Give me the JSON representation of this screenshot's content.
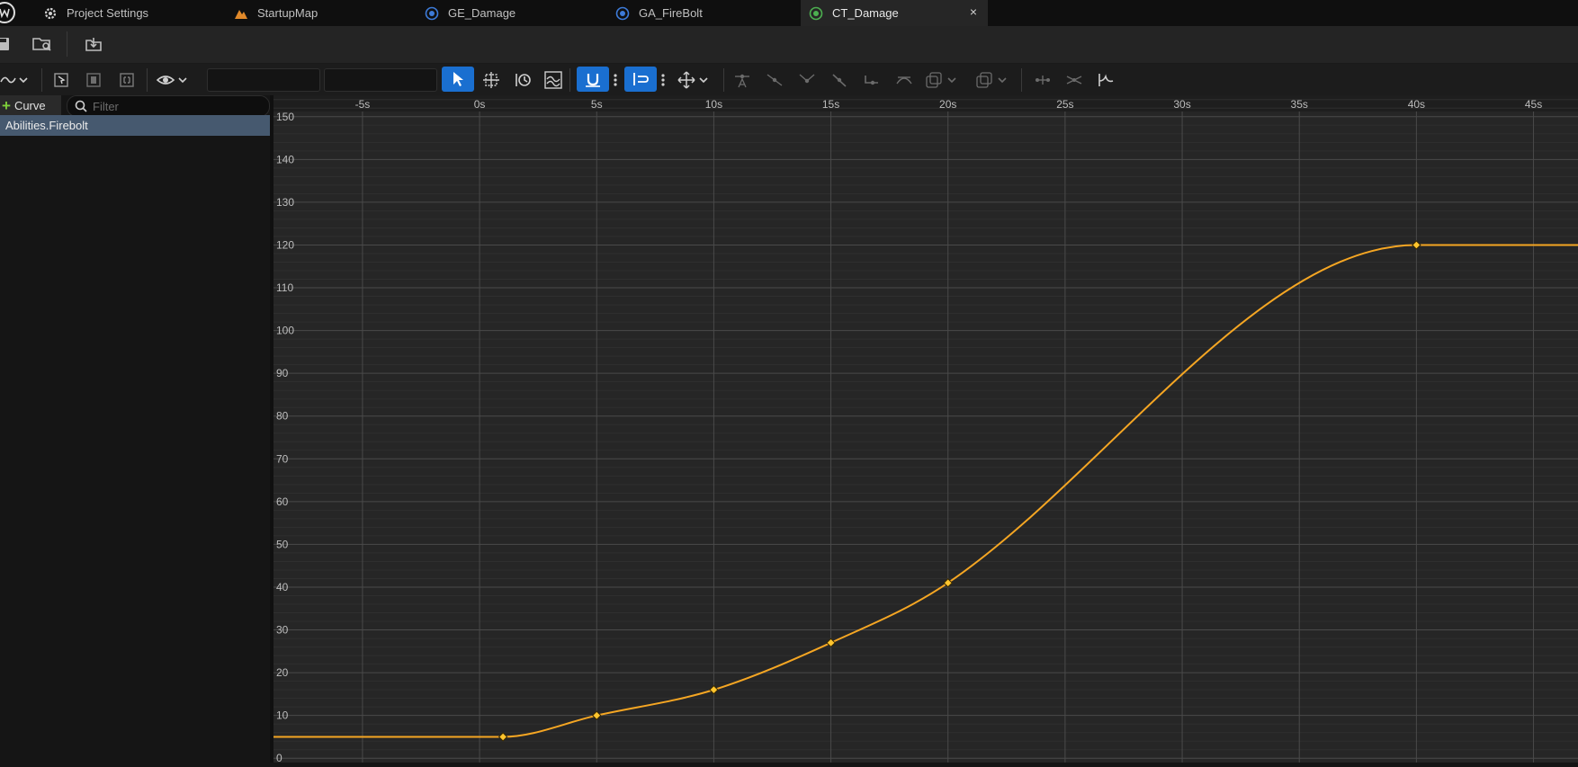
{
  "tabs": [
    {
      "label": "Project Settings",
      "icon": "gear-icon"
    },
    {
      "label": "StartupMap",
      "icon": "map-icon"
    },
    {
      "label": "GE_Damage",
      "icon": "blueprint-icon"
    },
    {
      "label": "GA_FireBolt",
      "icon": "blueprint-icon"
    },
    {
      "label": "CT_Damage",
      "icon": "curve-table-icon",
      "active": true
    }
  ],
  "close_symbol": "×",
  "left_panel": {
    "add_curve_label": "Curve",
    "filter_placeholder": "Filter",
    "rows": [
      "Abilities.Firebolt"
    ]
  },
  "colors": {
    "curve": "#f5a623",
    "selection": "#46596f",
    "accent": "#1a6fd0",
    "add": "#7ecf3a"
  },
  "chart_data": {
    "type": "line",
    "title": "",
    "xlabel": "",
    "ylabel": "",
    "x_ticks": [
      "-5s",
      "0s",
      "5s",
      "10s",
      "15s",
      "20s",
      "25s",
      "30s",
      "35s",
      "40s",
      "45s"
    ],
    "y_ticks": [
      "0",
      "10",
      "20",
      "30",
      "40",
      "50",
      "60",
      "70",
      "80",
      "90",
      "100",
      "110",
      "120",
      "130",
      "140",
      "150"
    ],
    "xlim": [
      -8.8,
      46.9
    ],
    "ylim": [
      -1,
      155
    ],
    "grid": true,
    "series": [
      {
        "keys": [
          {
            "x": 1,
            "y": 5
          },
          {
            "x": 5,
            "y": 10
          },
          {
            "x": 10,
            "y": 16
          },
          {
            "x": 15,
            "y": 27
          },
          {
            "x": 20,
            "y": 41
          },
          {
            "x": 40,
            "y": 120
          }
        ],
        "pre_infinity": 5,
        "post_infinity": 120
      }
    ]
  }
}
